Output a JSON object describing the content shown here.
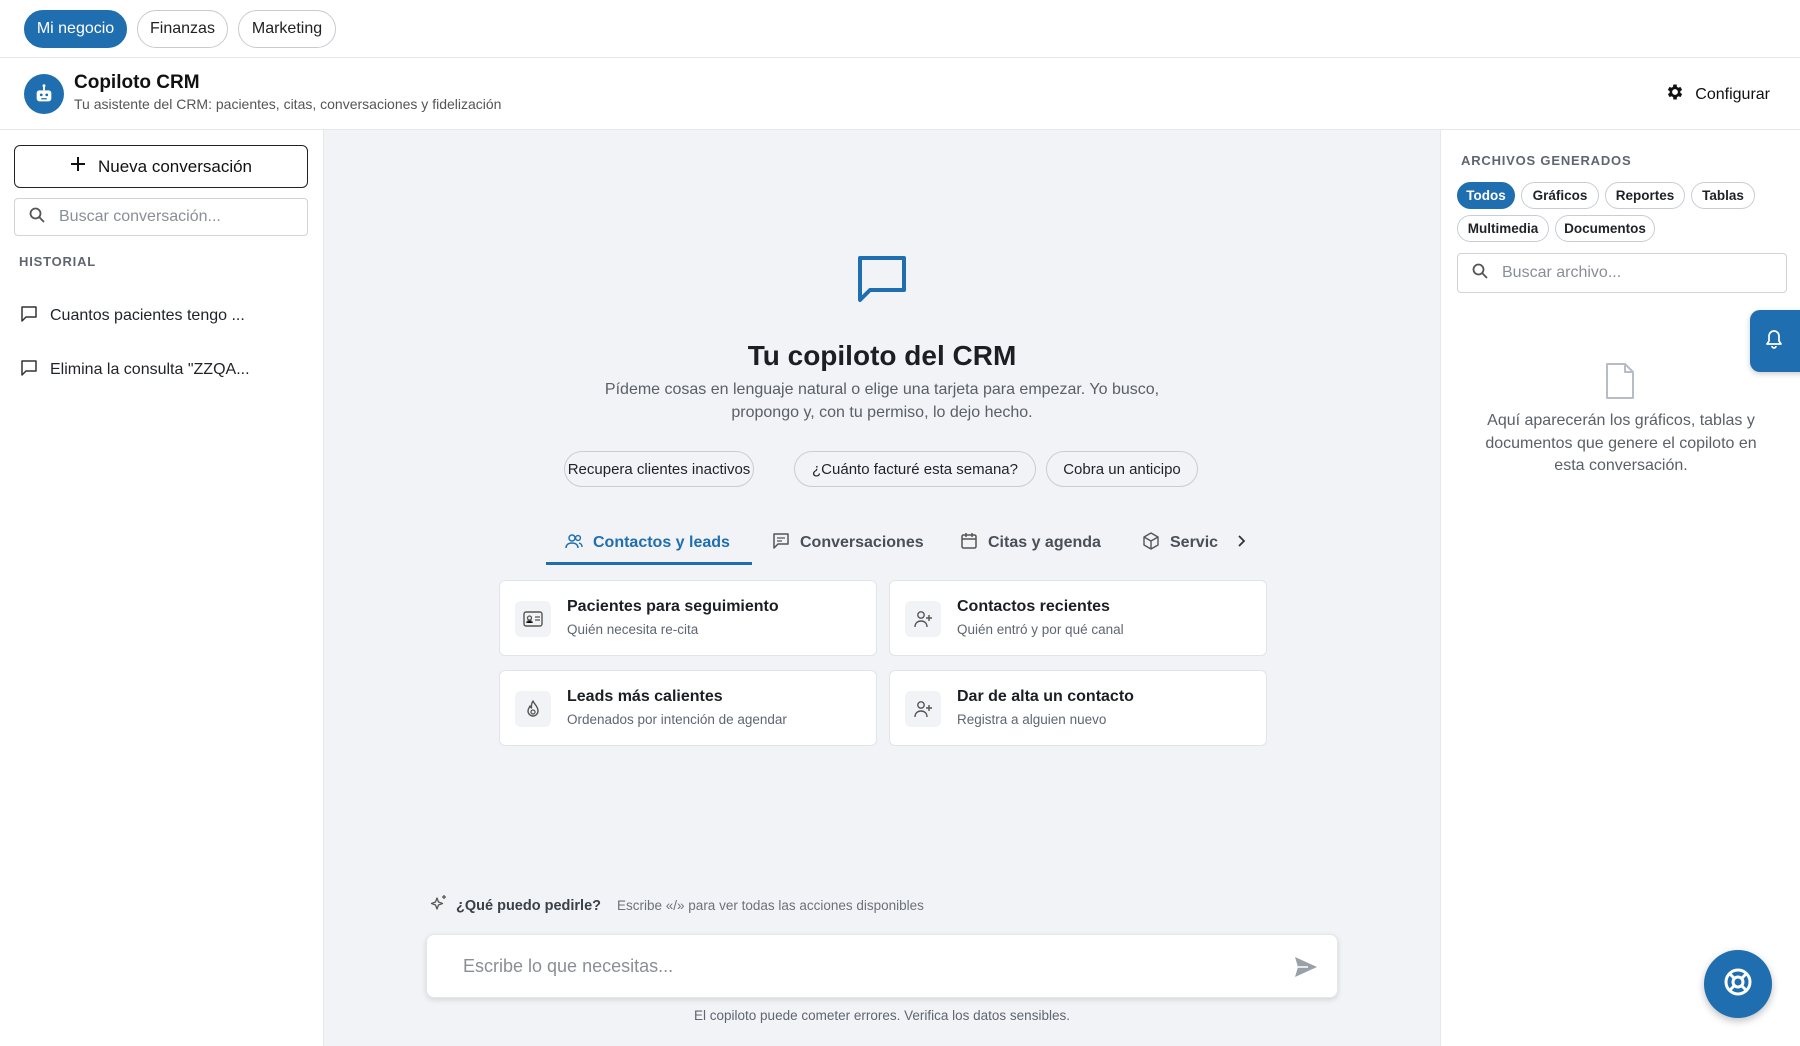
{
  "topnav": {
    "tabs": [
      {
        "label": "Mi negocio",
        "active": true
      },
      {
        "label": "Finanzas",
        "active": false
      },
      {
        "label": "Marketing",
        "active": false
      }
    ]
  },
  "header": {
    "title": "Copiloto CRM",
    "subtitle": "Tu asistente del CRM: pacientes, citas, conversaciones y fidelización",
    "config_label": "Configurar",
    "logo_icon": "robot-icon",
    "config_icon": "gear-icon"
  },
  "sidebar": {
    "new_conversation_label": "Nueva conversación",
    "search_placeholder": "Buscar conversación...",
    "history_label": "HISTORIAL",
    "history": [
      {
        "label": "Cuantos pacientes tengo ..."
      },
      {
        "label": "Elimina la consulta \"ZZQA..."
      }
    ]
  },
  "main": {
    "title": "Tu copiloto del CRM",
    "subtitle": "Pídeme cosas en lenguaje natural o elige una tarjeta para empezar. Yo busco, propongo y, con tu permiso, lo dejo hecho.",
    "suggestions": [
      {
        "label": "Recupera clientes inactivos"
      },
      {
        "label": "¿Cuánto facturé esta semana?"
      },
      {
        "label": "Cobra un anticipo"
      }
    ],
    "tabs": [
      {
        "label": "Contactos y leads",
        "icon": "users-icon",
        "active": true
      },
      {
        "label": "Conversaciones",
        "icon": "chat-icon",
        "active": false
      },
      {
        "label": "Citas y agenda",
        "icon": "calendar-icon",
        "active": false
      },
      {
        "label": "Servic",
        "icon": "box-icon",
        "active": false
      }
    ],
    "cards": [
      {
        "title": "Pacientes para seguimiento",
        "subtitle": "Quién necesita re-cita",
        "icon": "id-card-icon"
      },
      {
        "title": "Contactos recientes",
        "subtitle": "Quién entró y por qué canal",
        "icon": "user-plus-icon"
      },
      {
        "title": "Leads más calientes",
        "subtitle": "Ordenados por intención de agendar",
        "icon": "flame-icon"
      },
      {
        "title": "Dar de alta un contacto",
        "subtitle": "Registra a alguien nuevo",
        "icon": "user-plus-icon"
      }
    ],
    "hint_question": "¿Qué puedo pedirle?",
    "hint_text": "Escribe «/» para ver todas las acciones disponibles",
    "input_placeholder": "Escribe lo que necesitas...",
    "disclaimer": "El copiloto puede cometer errores. Verifica los datos sensibles."
  },
  "files": {
    "label": "ARCHIVOS GENERADOS",
    "filters": [
      {
        "label": "Todos",
        "active": true
      },
      {
        "label": "Gráficos",
        "active": false
      },
      {
        "label": "Reportes",
        "active": false
      },
      {
        "label": "Tablas",
        "active": false
      },
      {
        "label": "Multimedia",
        "active": false
      },
      {
        "label": "Documentos",
        "active": false
      }
    ],
    "search_placeholder": "Buscar archivo...",
    "empty_text": "Aquí aparecerán los gráficos, tablas y documentos que genere el copiloto en esta conversación."
  },
  "colors": {
    "accent": "#1f6eaf",
    "center_bg": "#f1f3f6"
  }
}
